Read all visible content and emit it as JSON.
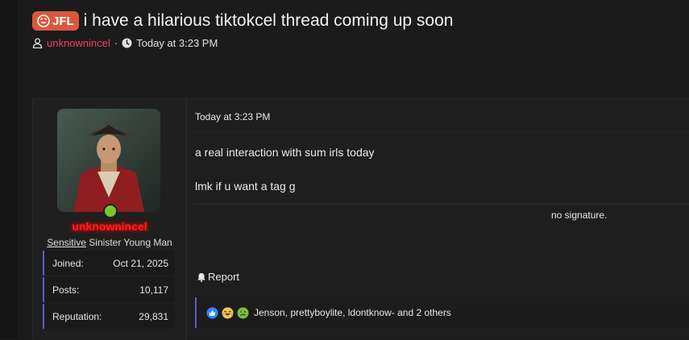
{
  "thread": {
    "prefix": "JFL",
    "title": "i have a hilarious tiktokcel thread coming up soon",
    "author": "unknownincel",
    "separator": "·",
    "timestamp": "Today at 3:23 PM"
  },
  "user": {
    "username": "unknownincel",
    "title_underlined": "Sensitive",
    "title_rest": " Sinister Young Man",
    "stats": [
      {
        "label": "Joined:",
        "value": "Oct 21, 2025"
      },
      {
        "label": "Posts:",
        "value": "10,117"
      },
      {
        "label": "Reputation:",
        "value": "29,831"
      }
    ]
  },
  "post": {
    "date": "Today at 3:23 PM",
    "lines": [
      "a real interaction with sum irls today",
      "lmk if u want a tag g"
    ],
    "signature": "no signature.",
    "report_label": "Report",
    "reactions_text": "Jenson, prettyboylite, ldontknow- and 2 others",
    "reaction_icons": [
      "like-icon",
      "laugh-icon",
      "sick-icon"
    ]
  },
  "colors": {
    "prefix_bg": "#d9583b",
    "author_link": "#ee3f6a",
    "username_glow": "#ff2020",
    "online": "#7ac72b",
    "accent_bar": "#5b5ec7"
  }
}
